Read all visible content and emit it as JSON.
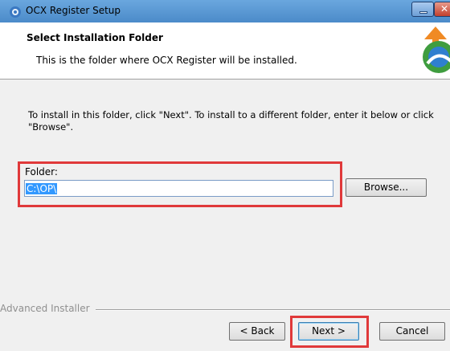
{
  "window": {
    "title": "OCX Register Setup",
    "close_glyph": "✕",
    "accent_color": "#4b8bc9"
  },
  "header": {
    "heading": "Select Installation Folder",
    "subheading": "This is the folder where OCX Register will be installed."
  },
  "body": {
    "instructions": "To install in this folder, click \"Next\". To install to a different folder, enter it below or click \"Browse\".",
    "folder_label": "Folder:",
    "folder_value": "C:\\OP\\",
    "browse_label": "Browse..."
  },
  "footer": {
    "brand": "Advanced Installer",
    "back_label": "< Back",
    "next_label": "Next >",
    "cancel_label": "Cancel"
  },
  "highlight_color": "#e0393a"
}
